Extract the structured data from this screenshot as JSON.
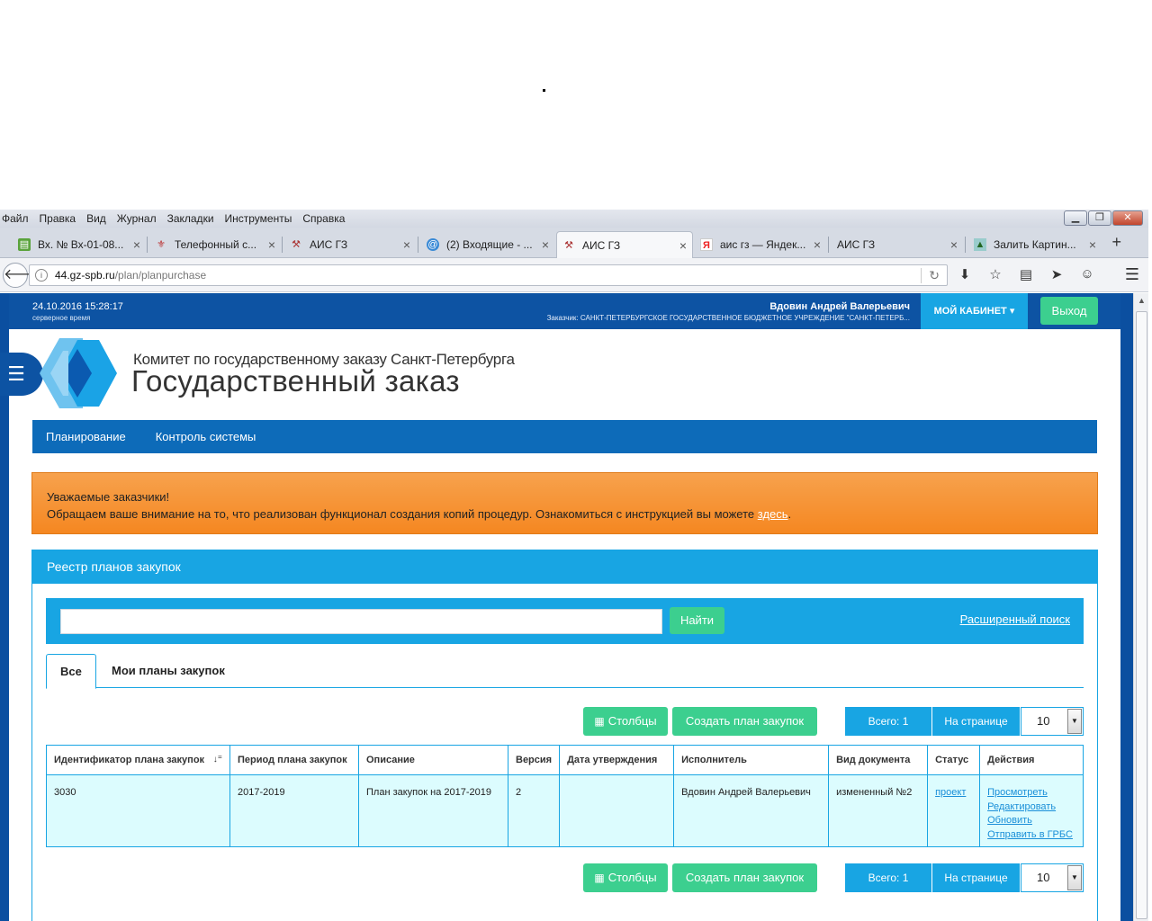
{
  "browser": {
    "menu": [
      "Файл",
      "Правка",
      "Вид",
      "Журнал",
      "Закладки",
      "Инструменты",
      "Справка"
    ],
    "tabs": [
      {
        "label": "Вх. № Вх-01-08...",
        "icon": "doc-icon",
        "active": false
      },
      {
        "label": "Телефонный с...",
        "icon": "seal-icon",
        "active": false
      },
      {
        "label": "АИС ГЗ",
        "icon": "gavel-icon",
        "active": false
      },
      {
        "label": "(2) Входящие - ...",
        "icon": "mail-icon",
        "active": false
      },
      {
        "label": "АИС ГЗ",
        "icon": "gavel-icon",
        "active": true
      },
      {
        "label": "аис гз — Яндек...",
        "icon": "yandex-icon",
        "active": false
      },
      {
        "label": "АИС ГЗ",
        "icon": "",
        "active": false
      },
      {
        "label": "Залить Картин...",
        "icon": "image-icon",
        "active": false
      }
    ],
    "url_host": "44.gz-spb.ru",
    "url_path": "/plan/planpurchase"
  },
  "header": {
    "datetime": "24.10.2016 15:28:17",
    "server_time_label": "серверное время",
    "user_name": "Вдовин Андрей Валерьевич",
    "customer": "Заказчик: САНКТ-ПЕТЕРБУРГСКОЕ ГОСУДАРСТВЕННОЕ БЮДЖЕТНОЕ УЧРЕЖДЕНИЕ \"САНКТ-ПЕТЕРБ...",
    "cabinet_label": "МОЙ КАБИНЕТ",
    "logout_label": "Выход"
  },
  "logo": {
    "line1": "Комитет по государственному заказу Санкт-Петербурга",
    "line2": "Государственный заказ"
  },
  "nav": [
    "Планирование",
    "Контроль системы"
  ],
  "alert": {
    "line1": "Уважаемые заказчики!",
    "line2": "Обращаем ваше внимание на то, что реализован функционал создания копий процедур. Ознакомиться с инструкцией вы можете",
    "link": "здесь",
    "end": "."
  },
  "registry": {
    "title": "Реестр планов закупок",
    "search_value": "",
    "find_label": "Найти",
    "advanced_label": "Расширенный поиск",
    "tabs": [
      "Все",
      "Мои планы закупок"
    ],
    "columns_label": "Столбцы",
    "create_label": "Создать план закупок",
    "total_label": "Всего: 1",
    "per_page_label": "На странице",
    "per_page_value": "10",
    "headers": [
      "Идентификатор плана закупок",
      "Период плана закупок",
      "Описание",
      "Версия",
      "Дата утверждения",
      "Исполнитель",
      "Вид документа",
      "Статус",
      "Действия"
    ],
    "rows": [
      {
        "id": "3030",
        "period": "2017-2019",
        "description": "План закупок на 2017-2019",
        "version": "2",
        "approved": "",
        "executor": "Вдовин Андрей Валерьевич",
        "doc_type": "измененный №2",
        "status": "проект",
        "actions": [
          "Просмотреть",
          "Редактировать",
          "Обновить",
          "Отправить в ГРБС"
        ]
      }
    ]
  },
  "colors": {
    "dark_blue": "#0d53a3",
    "light_blue": "#18a5e3",
    "green": "#3ccf8f",
    "orange": "#f58721"
  }
}
